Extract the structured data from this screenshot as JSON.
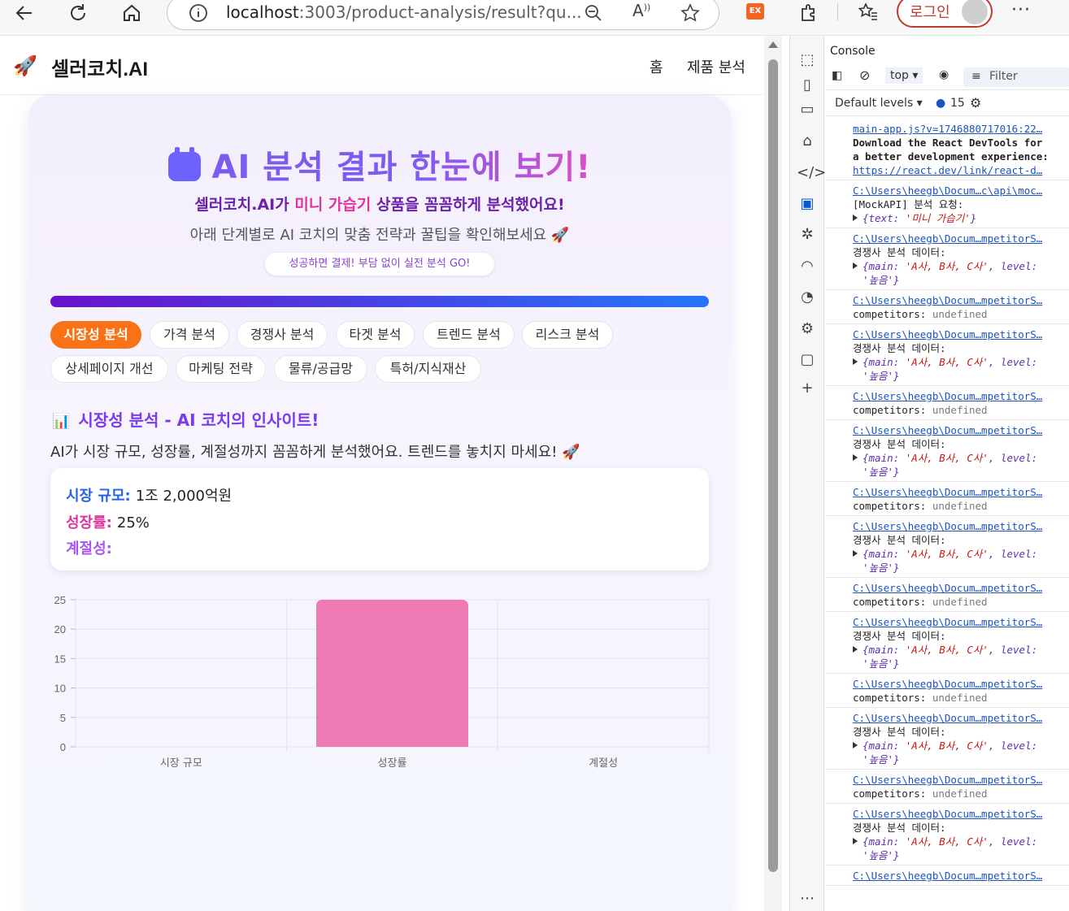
{
  "browser": {
    "url_host": "localhost",
    "url_rest": ":3003/product-analysis/result?qu...",
    "login_label": "로그인",
    "ext_label": "EX"
  },
  "site": {
    "logo_icon": "🚀",
    "brand": "셀러코치.AI",
    "nav": [
      "홈",
      "제품 분석"
    ]
  },
  "hero": {
    "title_prefix": "AI 분석 결과 ",
    "title_grad": "한눈에 보기!",
    "sub_1": "셀러코치.AI가 ",
    "sub_hl": "미니 가습기",
    "sub_2": " 상품을 꼼꼼하게 분석했어요!",
    "desc": "아래 단계별로 AI 코치의 맞춤 전략과 꿀팁을 확인해보세요 🚀",
    "badge": "성공하면 결제! 부담 없이 실전 분석 GO!"
  },
  "tabs": [
    {
      "label": "시장성 분석",
      "active": true
    },
    {
      "label": "가격 분석",
      "active": false
    },
    {
      "label": "경쟁사 분석",
      "active": false
    },
    {
      "label": "타겟 분석",
      "active": false
    },
    {
      "label": "트렌드 분석",
      "active": false
    },
    {
      "label": "리스크 분석",
      "active": false
    },
    {
      "label": "상세페이지 개선",
      "active": false
    },
    {
      "label": "마케팅 전략",
      "active": false
    },
    {
      "label": "물류/공급망",
      "active": false
    },
    {
      "label": "특허/지식재산",
      "active": false
    }
  ],
  "section": {
    "icon": "📊",
    "title": "시장성 분석 - AI 코치의 인사이트!",
    "desc": "AI가 시장 규모, 성장률, 계절성까지 꼼꼼하게 분석했어요. 트렌드를 놓치지 마세요! 🚀",
    "market_size_label": "시장 규모:",
    "market_size_value": "1조 2,000억원",
    "growth_label": "성장률:",
    "growth_value": "25%",
    "season_label": "계절성:",
    "season_value": "",
    "colors": {
      "market": "#2563eb",
      "growth": "#e0359c",
      "season": "#a855f7"
    }
  },
  "chart_data": {
    "type": "bar",
    "categories": [
      "시장 규모",
      "성장률",
      "계절성"
    ],
    "values": [
      0,
      25,
      0
    ],
    "ylim": [
      0,
      25
    ],
    "yticks": [
      0,
      5,
      10,
      15,
      20,
      25
    ],
    "bar_color": "#ee7ab4",
    "grid": true
  },
  "devtools": {
    "panel_title": "Console",
    "context": "top",
    "filter_placeholder": "Filter",
    "levels": "Default levels",
    "issue_count": "15",
    "logs": [
      {
        "src": "main-app.js?v=1746880717016:22…",
        "msg_bold": "Download the React DevTools for a better development experience:",
        "link": "https://react.dev/link/react-d…"
      },
      {
        "src": "C:\\Users\\heegb\\Docum…c\\api\\moc…",
        "msg": "[MockAPI] 분석 요청:",
        "obj_key": "{text: ",
        "obj_val": "'미니 가습기'",
        "obj_end": "}"
      },
      {
        "src": "C:\\Users\\heegb\\Docum…mpetitorS…",
        "msg": "경쟁사 분석 데이터:",
        "obj_key": "{main: ",
        "obj_val": "'A사, B사, C사'",
        "obj_end": ", level: '높음'}"
      },
      {
        "src": "C:\\Users\\heegb\\Docum…mpetitorS…",
        "msg": "competitors:",
        "und": "undefined"
      },
      {
        "src": "C:\\Users\\heegb\\Docum…mpetitorS…",
        "msg": "경쟁사 분석 데이터:",
        "obj_key": "{main: ",
        "obj_val": "'A사, B사, C사'",
        "obj_end": ", level: '높음'}"
      },
      {
        "src": "C:\\Users\\heegb\\Docum…mpetitorS…",
        "msg": "competitors:",
        "und": "undefined"
      },
      {
        "src": "C:\\Users\\heegb\\Docum…mpetitorS…",
        "msg": "경쟁사 분석 데이터:",
        "obj_key": "{main: ",
        "obj_val": "'A사, B사, C사'",
        "obj_end": ", level: '높음'}"
      },
      {
        "src": "C:\\Users\\heegb\\Docum…mpetitorS…",
        "msg": "competitors:",
        "und": "undefined"
      },
      {
        "src": "C:\\Users\\heegb\\Docum…mpetitorS…",
        "msg": "경쟁사 분석 데이터:",
        "obj_key": "{main: ",
        "obj_val": "'A사, B사, C사'",
        "obj_end": ", level: '높음'}"
      },
      {
        "src": "C:\\Users\\heegb\\Docum…mpetitorS…",
        "msg": "competitors:",
        "und": "undefined"
      },
      {
        "src": "C:\\Users\\heegb\\Docum…mpetitorS…",
        "msg": "경쟁사 분석 데이터:",
        "obj_key": "{main: ",
        "obj_val": "'A사, B사, C사'",
        "obj_end": ", level: '높음'}"
      },
      {
        "src": "C:\\Users\\heegb\\Docum…mpetitorS…",
        "msg": "competitors:",
        "und": "undefined"
      },
      {
        "src": "C:\\Users\\heegb\\Docum…mpetitorS…",
        "msg": "경쟁사 분석 데이터:",
        "obj_key": "{main: ",
        "obj_val": "'A사, B사, C사'",
        "obj_end": ", level: '높음'}"
      },
      {
        "src": "C:\\Users\\heegb\\Docum…mpetitorS…",
        "msg": "competitors:",
        "und": "undefined"
      },
      {
        "src": "C:\\Users\\heegb\\Docum…mpetitorS…",
        "msg": "경쟁사 분석 데이터:",
        "obj_key": "{main: ",
        "obj_val": "'A사, B사, C사'",
        "obj_end": ", level: '높음'}"
      },
      {
        "src": "C:\\Users\\heegb\\Docum…mpetitorS…",
        "msg": "",
        "und": ""
      }
    ]
  }
}
